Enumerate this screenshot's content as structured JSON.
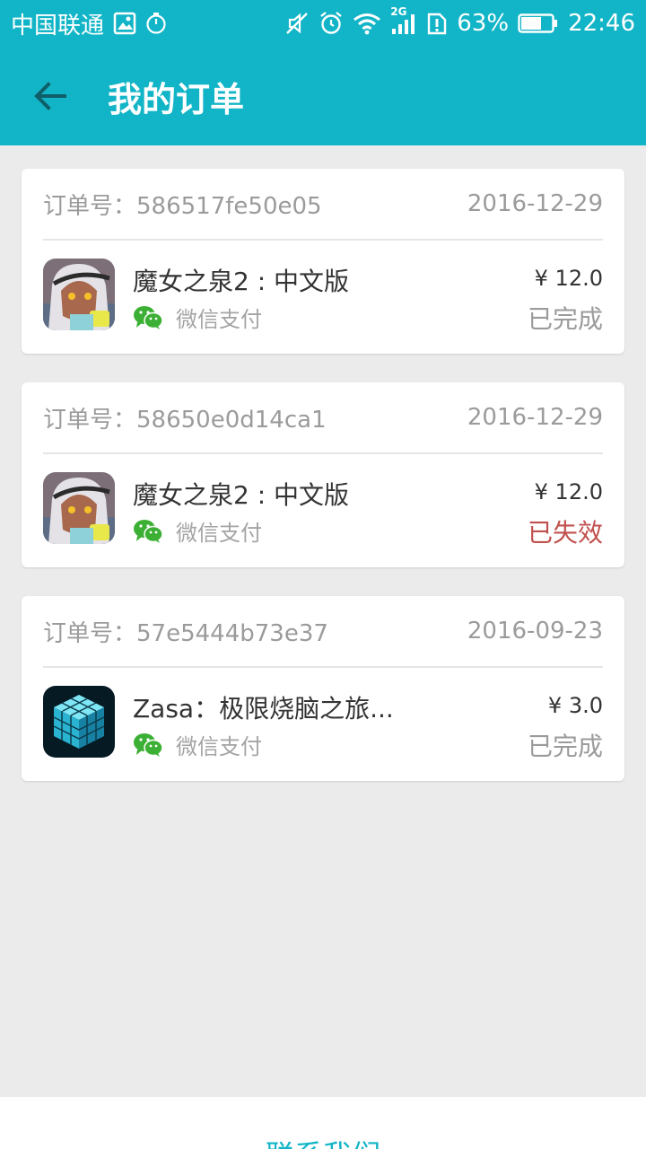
{
  "status_bar": {
    "carrier": "中国联通",
    "network": "2G",
    "battery": "63%",
    "time": "22:46",
    "icons": [
      "image-icon",
      "timer-icon",
      "mute-icon",
      "alarm-icon",
      "wifi-icon",
      "signal-icon",
      "sim-alert-icon",
      "battery-icon"
    ]
  },
  "header": {
    "title": "我的订单",
    "back_icon": "arrow-left-icon"
  },
  "colors": {
    "accent": "#12b5c7",
    "failed": "#c0504d",
    "wechat": "#3cb034"
  },
  "orders": [
    {
      "order_label": "订单号：",
      "order_id": "586517fe50e05",
      "date": "2016-12-29",
      "game": "魔女之泉2 : 中文版",
      "game_icon": "witch-spring-icon",
      "pay_method": "微信支付",
      "price": "¥ 12.0",
      "status": "已完成",
      "status_type": "done"
    },
    {
      "order_label": "订单号：",
      "order_id": "58650e0d14ca1",
      "date": "2016-12-29",
      "game": "魔女之泉2 : 中文版",
      "game_icon": "witch-spring-icon",
      "pay_method": "微信支付",
      "price": "¥ 12.0",
      "status": "已失效",
      "status_type": "failed"
    },
    {
      "order_label": "订单号：",
      "order_id": "57e5444b73e37",
      "date": "2016-09-23",
      "game": "Zasa：极限烧脑之旅...",
      "game_icon": "cube-icon",
      "pay_method": "微信支付",
      "price": "¥ 3.0",
      "status": "已完成",
      "status_type": "done"
    }
  ],
  "footer": {
    "contact_label": "联系我们"
  }
}
